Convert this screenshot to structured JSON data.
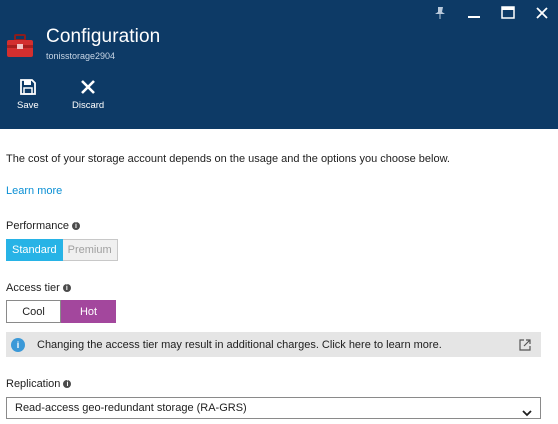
{
  "window": {
    "controls": [
      "pin-icon",
      "minimize-icon",
      "maximize-icon",
      "close-icon"
    ]
  },
  "header": {
    "title": "Configuration",
    "subtitle": "tonisstorage2904",
    "icon": "toolbox-icon"
  },
  "commands": {
    "save_label": "Save",
    "discard_label": "Discard"
  },
  "content": {
    "description": "The cost of your storage account depends on the usage and the options you choose below.",
    "learn_more": "Learn more"
  },
  "performance": {
    "label": "Performance",
    "options": [
      "Standard",
      "Premium"
    ],
    "selected": "Standard"
  },
  "access_tier": {
    "label": "Access tier",
    "options": [
      "Cool",
      "Hot"
    ],
    "selected": "Hot"
  },
  "info_bar": {
    "text": "Changing the access tier may result in additional charges. Click here to learn more."
  },
  "replication": {
    "label": "Replication",
    "selected_value": "Read-access geo-redundant storage (RA-GRS)"
  },
  "colors": {
    "header_bg": "#0d3a66",
    "link": "#0a8fd4",
    "performance_selected": "#27b3e6",
    "tier_selected": "#a3479d",
    "info_bar_bg": "#e5e5e5"
  }
}
